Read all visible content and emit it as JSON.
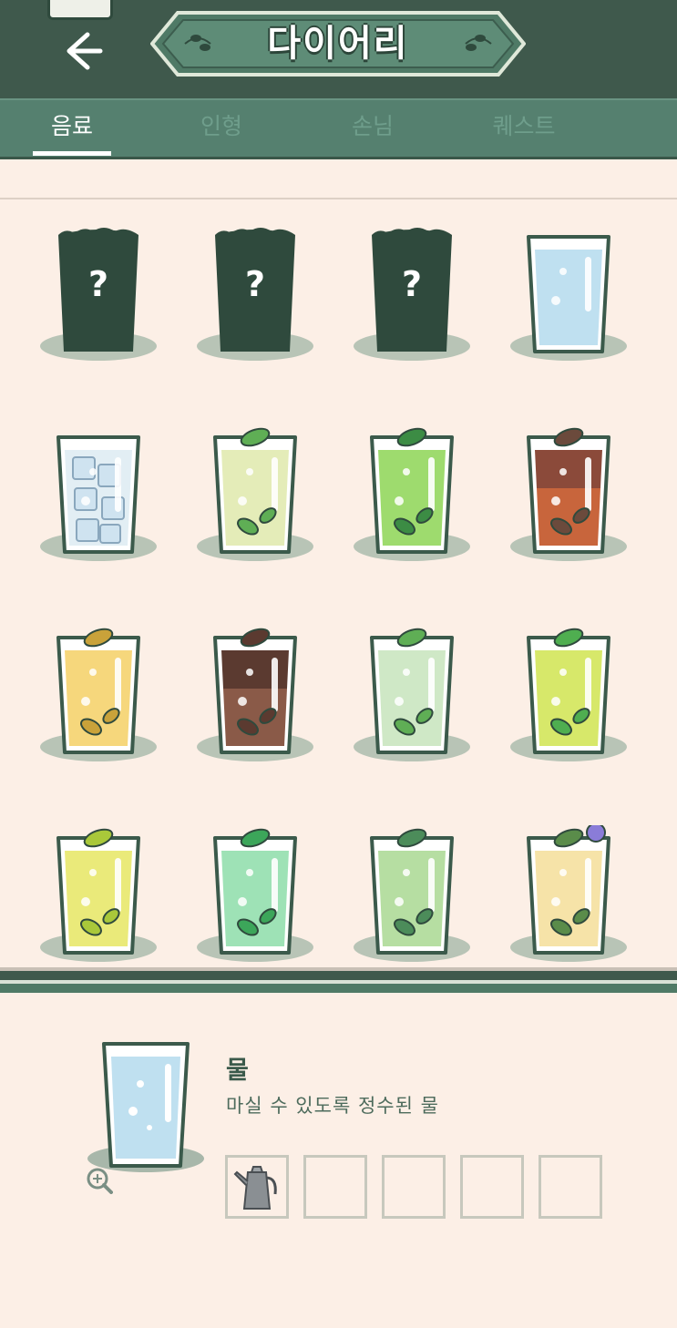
{
  "header": {
    "title": "다이어리"
  },
  "tabs": [
    {
      "label": "음료"
    },
    {
      "label": "인형"
    },
    {
      "label": "손님"
    },
    {
      "label": "퀘스트"
    }
  ],
  "grid": {
    "items": [
      {
        "kind": "locked",
        "label": "?"
      },
      {
        "kind": "locked",
        "label": "?"
      },
      {
        "kind": "locked",
        "label": "?"
      },
      {
        "kind": "water"
      },
      {
        "kind": "ice"
      },
      {
        "kind": "lime-mint"
      },
      {
        "kind": "green-mint"
      },
      {
        "kind": "orange-brown"
      },
      {
        "kind": "yellow-leaf"
      },
      {
        "kind": "brown-drink"
      },
      {
        "kind": "pale-green"
      },
      {
        "kind": "yellow-green"
      },
      {
        "kind": "yellow-lemon"
      },
      {
        "kind": "mint-green"
      },
      {
        "kind": "herb-green"
      },
      {
        "kind": "rosemary-flower"
      }
    ]
  },
  "detail": {
    "name": "물",
    "description": "마실 수 있도록 정수된 물",
    "ingredients": [
      "kettle-icon",
      "",
      "",
      "",
      ""
    ]
  },
  "colors": {
    "header_bg": "#3f594c",
    "tab_bg": "#55806f",
    "page_bg": "#fcefe6",
    "locked_cup": "#2f4a3d"
  }
}
